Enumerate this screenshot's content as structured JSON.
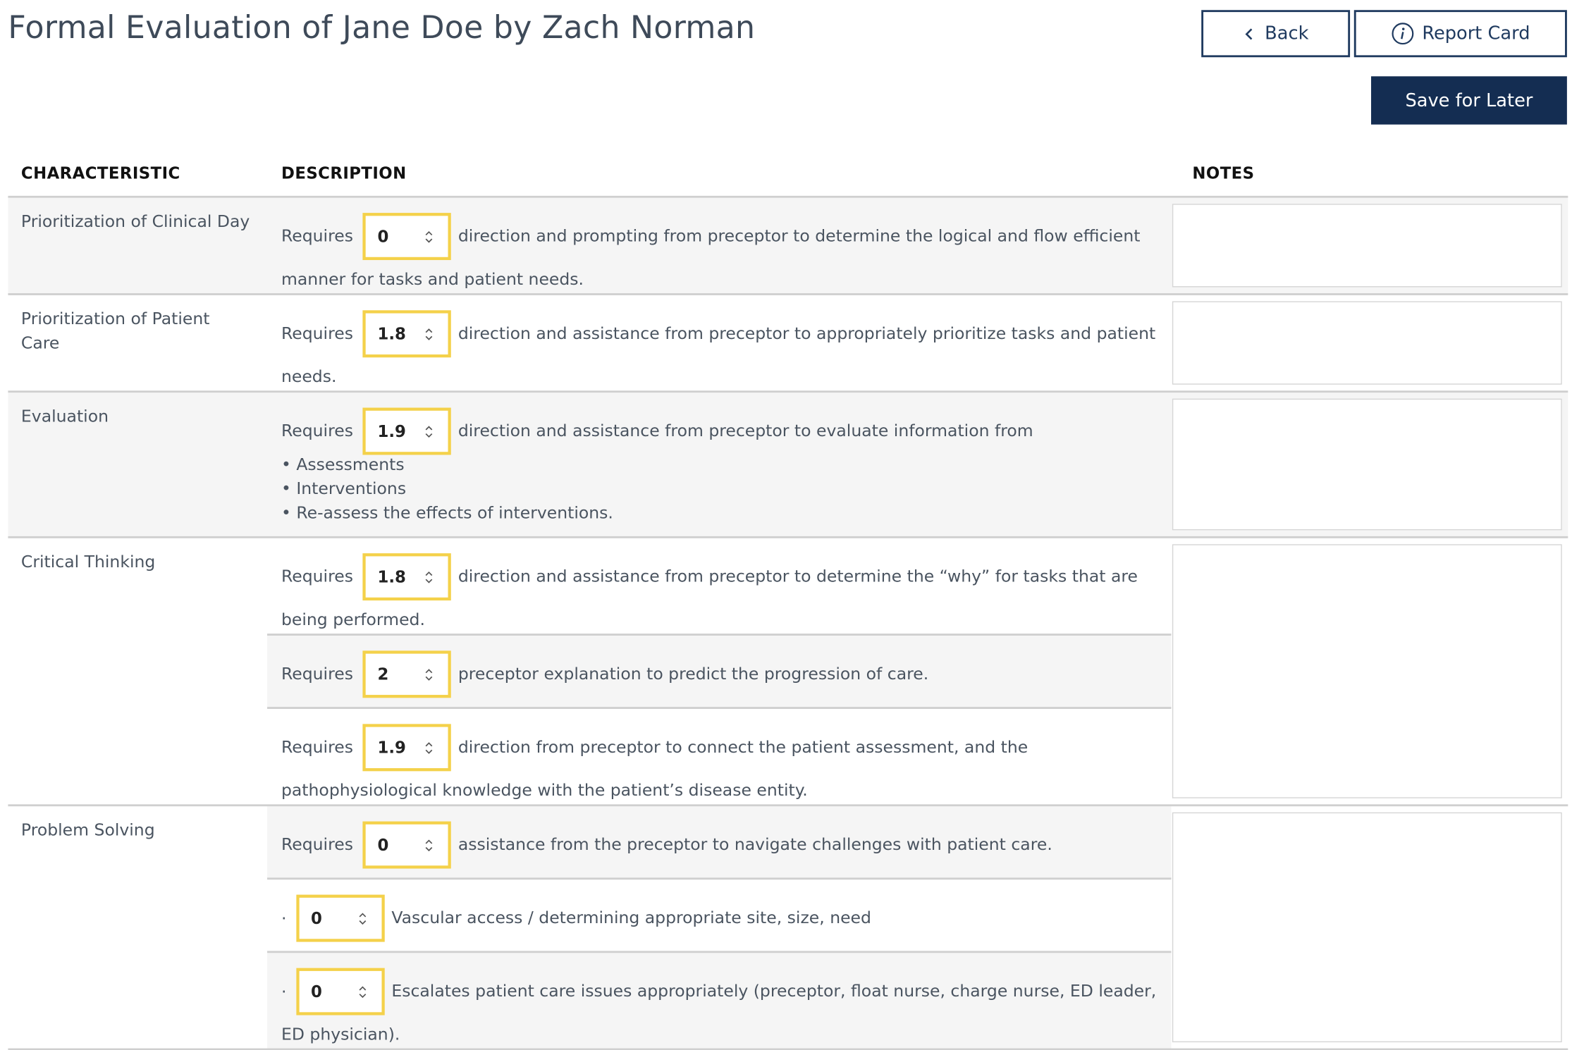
{
  "header": {
    "title": "Formal Evaluation of Jane Doe by Zach Norman",
    "back_label": "Back",
    "report_card_label": "Report Card",
    "save_label": "Save for Later"
  },
  "table": {
    "col_characteristic": "CHARACTERISTIC",
    "col_description": "DESCRIPTION",
    "col_notes": "NOTES"
  },
  "rows": [
    {
      "characteristic": "Prioritization of Clinical Day",
      "items": [
        {
          "prefix": "Requires",
          "value": "0",
          "text": "direction and prompting from preceptor to determine the logical and flow efficient manner for tasks and patient needs."
        }
      ]
    },
    {
      "characteristic": "Prioritization of Patient Care",
      "items": [
        {
          "prefix": "Requires",
          "value": "1.8",
          "text": "direction and assistance from preceptor to appropriately prioritize tasks and patient needs."
        }
      ]
    },
    {
      "characteristic": "Evaluation",
      "items": [
        {
          "prefix": "Requires",
          "value": "1.9",
          "text": "direction and assistance from preceptor to evaluate information from",
          "bullets": [
            "• Assessments",
            "• Interventions",
            "• Re-assess the effects of interventions."
          ]
        }
      ]
    },
    {
      "characteristic": "Critical Thinking",
      "items": [
        {
          "prefix": "Requires",
          "value": "1.8",
          "text": "direction and assistance from preceptor to determine the “why” for tasks that are being performed."
        },
        {
          "prefix": "Requires",
          "value": "2",
          "text": "preceptor explanation to predict the progression of care."
        },
        {
          "prefix": "Requires",
          "value": "1.9",
          "text": "direction from preceptor to connect the patient assessment, and the pathophysiological knowledge with the patient’s disease entity."
        }
      ]
    },
    {
      "characteristic": "Problem Solving",
      "items": [
        {
          "prefix": "Requires",
          "value": "0",
          "text": "assistance from the preceptor to navigate challenges with patient care."
        },
        {
          "prefix": "·",
          "value": "0",
          "text": "Vascular access / determining appropriate site, size, need"
        },
        {
          "prefix": "·",
          "value": "0",
          "text": "Escalates patient care issues appropriately (preceptor, float nurse, charge nurse, ED leader, ED physician)."
        }
      ]
    }
  ],
  "colors": {
    "primary": "#142d52",
    "highlight": "#f4d14a",
    "row_gray": "#f5f5f5"
  }
}
